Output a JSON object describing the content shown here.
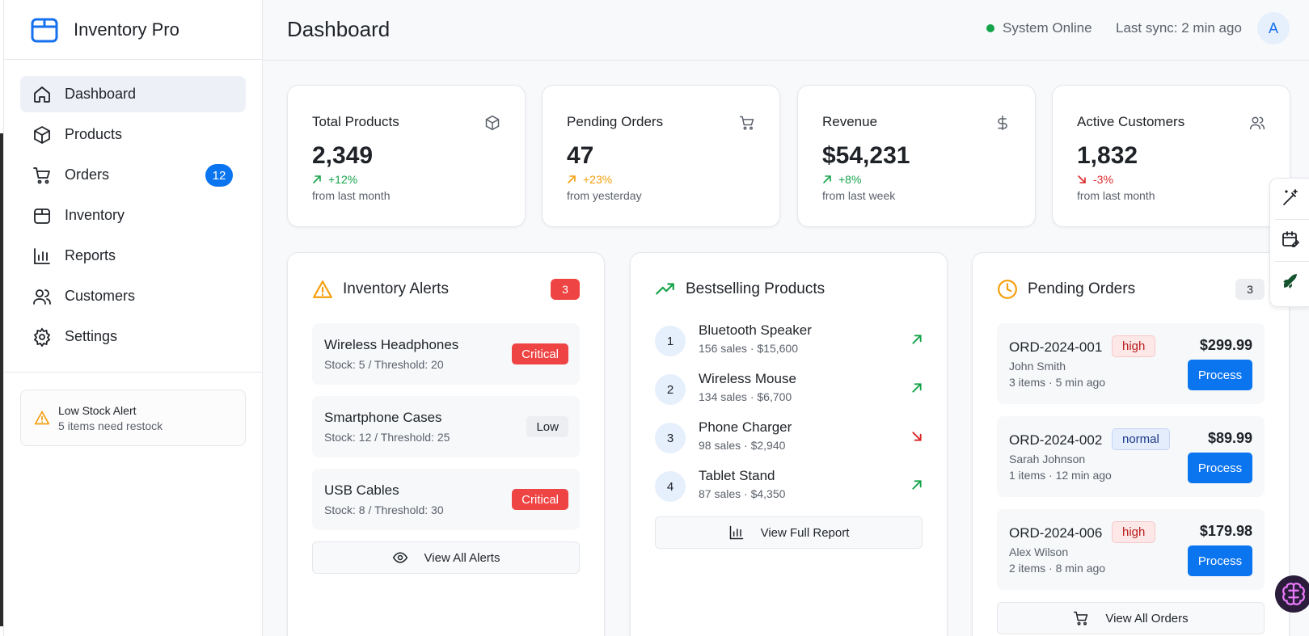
{
  "brand": {
    "title": "Inventory Pro"
  },
  "sidebar": {
    "items": [
      {
        "label": "Dashboard",
        "icon": "home-icon"
      },
      {
        "label": "Products",
        "icon": "box-icon"
      },
      {
        "label": "Orders",
        "icon": "cart-icon",
        "badge": "12"
      },
      {
        "label": "Inventory",
        "icon": "package-icon"
      },
      {
        "label": "Reports",
        "icon": "bar-chart-icon"
      },
      {
        "label": "Customers",
        "icon": "users-icon"
      },
      {
        "label": "Settings",
        "icon": "gear-icon"
      }
    ],
    "low_stock": {
      "title": "Low Stock Alert",
      "text": "5 items need restock"
    }
  },
  "header": {
    "title": "Dashboard",
    "status": "System Online",
    "sync": "Last sync: 2 min ago",
    "avatar": "A"
  },
  "stats": [
    {
      "label": "Total Products",
      "value": "2,349",
      "change": "+12%",
      "period": "from last month",
      "icon": "box-icon",
      "trend": "up",
      "color": "#16a34a"
    },
    {
      "label": "Pending Orders",
      "value": "47",
      "change": "+23%",
      "period": "from yesterday",
      "icon": "cart-icon",
      "trend": "up",
      "color": "#f59e0b"
    },
    {
      "label": "Revenue",
      "value": "$54,231",
      "change": "+8%",
      "period": "from last week",
      "icon": "dollar-icon",
      "trend": "up",
      "color": "#16a34a"
    },
    {
      "label": "Active Customers",
      "value": "1,832",
      "change": "-3%",
      "period": "from last month",
      "icon": "users-icon",
      "trend": "down",
      "color": "#dc2626"
    }
  ],
  "alerts": {
    "title": "Inventory Alerts",
    "count": "3",
    "items": [
      {
        "name": "Wireless Headphones",
        "stock": "Stock: 5 / Threshold: 20",
        "level": "Critical"
      },
      {
        "name": "Smartphone Cases",
        "stock": "Stock: 12 / Threshold: 25",
        "level": "Low"
      },
      {
        "name": "USB Cables",
        "stock": "Stock: 8 / Threshold: 30",
        "level": "Critical"
      }
    ],
    "button": "View All Alerts"
  },
  "bestsellers": {
    "title": "Bestselling Products",
    "items": [
      {
        "rank": "1",
        "name": "Bluetooth Speaker",
        "meta": "156 sales · $15,600",
        "trend": "up"
      },
      {
        "rank": "2",
        "name": "Wireless Mouse",
        "meta": "134 sales · $6,700",
        "trend": "up"
      },
      {
        "rank": "3",
        "name": "Phone Charger",
        "meta": "98 sales · $2,940",
        "trend": "down"
      },
      {
        "rank": "4",
        "name": "Tablet Stand",
        "meta": "87 sales · $4,350",
        "trend": "up"
      }
    ],
    "button": "View Full Report"
  },
  "pending": {
    "title": "Pending Orders",
    "count": "3",
    "orders": [
      {
        "id": "ORD-2024-001",
        "priority": "high",
        "customer": "John Smith",
        "info": "3 items · 5 min ago",
        "amount": "$299.99",
        "action": "Process"
      },
      {
        "id": "ORD-2024-002",
        "priority": "normal",
        "customer": "Sarah Johnson",
        "info": "1 items · 12 min ago",
        "amount": "$89.99",
        "action": "Process"
      },
      {
        "id": "ORD-2024-006",
        "priority": "high",
        "customer": "Alex Wilson",
        "info": "2 items · 8 min ago",
        "amount": "$179.98",
        "action": "Process"
      }
    ],
    "button": "View All Orders"
  },
  "colors": {
    "accent": "#0b74ef",
    "critical": "#ef4444",
    "success": "#16a34a",
    "warning": "#f59e0b"
  }
}
